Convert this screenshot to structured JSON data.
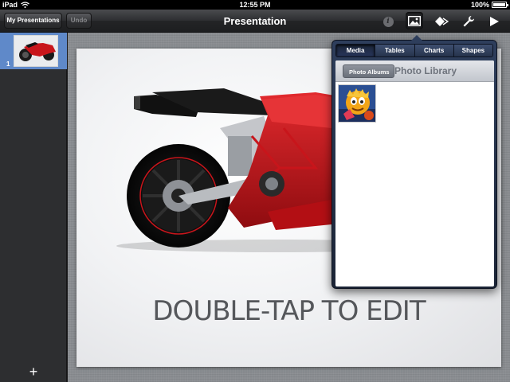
{
  "statusbar": {
    "device": "iPad",
    "time": "12:55 PM",
    "battery": "100%",
    "battery_level": 1.0
  },
  "toolbar": {
    "my_presentations_label": "My Presentations",
    "undo_label": "Undo",
    "title": "Presentation",
    "icons": [
      "info-icon",
      "media-icon",
      "shapes-icon",
      "wrench-icon",
      "play-icon"
    ]
  },
  "navigator": {
    "slides": [
      {
        "number": "1"
      }
    ],
    "add_label": "+"
  },
  "slide": {
    "placeholder_text": "DOUBLE-TAP TO EDIT"
  },
  "popover": {
    "tabs": [
      "Media",
      "Tables",
      "Charts",
      "Shapes"
    ],
    "selected_tab": "Media",
    "back_label": "Photo Albums",
    "title": "Photo Library"
  },
  "colors": {
    "accent_blue": "#5f89c9",
    "motorcycle_red": "#c8151b",
    "popover_frame": "#1f2a40"
  }
}
